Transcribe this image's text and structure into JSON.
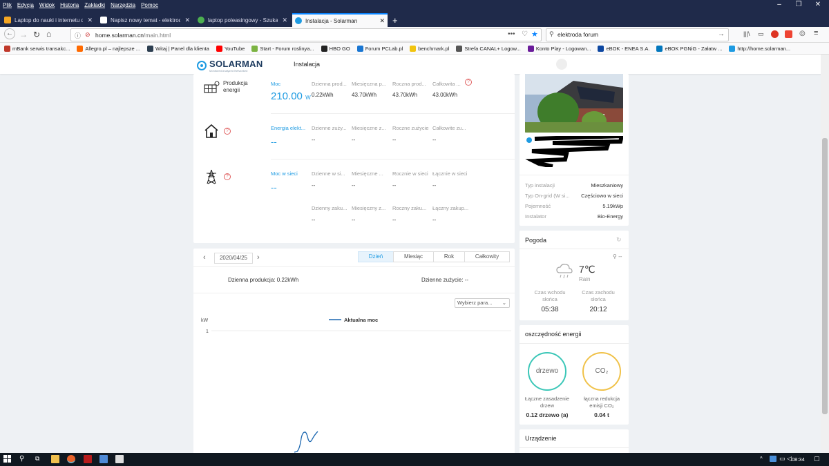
{
  "browser": {
    "menu": [
      "Plik",
      "Edycja",
      "Widok",
      "Historia",
      "Zakładki",
      "Narzędzia",
      "Pomoc"
    ],
    "tabs": [
      {
        "title": "Laptop do nauki i internetu do",
        "color": "#f5a623"
      },
      {
        "title": "Napisz nowy temat - elektroda",
        "color": "#ffffff"
      },
      {
        "title": "laptop poleasingowy - Szukaj w",
        "color": "#4caf50"
      },
      {
        "title": "Instalacja - Solarman",
        "color": "#1e9be2"
      }
    ],
    "url_host": "home.solarman.cn",
    "url_path": "/main.html",
    "search_value": "elektroda forum",
    "bookmarks": [
      {
        "label": "mBank serwis transakc...",
        "color": "#c0392b"
      },
      {
        "label": "Allegro.pl – najlepsze ...",
        "color": "#ff6a00"
      },
      {
        "label": "Witaj | Panel dla klienta",
        "color": "#2c3e50"
      },
      {
        "label": "YouTube",
        "color": "#ff0000"
      },
      {
        "label": "Start - Forum roslinya...",
        "color": "#7cb342"
      },
      {
        "label": "HBO GO",
        "color": "#222222"
      },
      {
        "label": "Forum PCLab.pl",
        "color": "#1976d2"
      },
      {
        "label": "benchmark.pl",
        "color": "#f1c40f"
      },
      {
        "label": "Strefa CANAL+ Logow...",
        "color": "#555555"
      },
      {
        "label": "Konto Play - Logowan...",
        "color": "#6a1b9a"
      },
      {
        "label": "eBOK - ENEA S.A.",
        "color": "#0d47a1"
      },
      {
        "label": "eBOK PGNiG - Załatw ...",
        "color": "#0277bd"
      },
      {
        "label": "http://home.solarman...",
        "color": "#1e9be2"
      }
    ]
  },
  "app": {
    "logo": "SOLARMAN",
    "logo_sub": "Monitored Analyzed Networked",
    "nav": "Instalacja"
  },
  "energy": {
    "production": {
      "title": "Produkcja energii",
      "power_label": "Moc",
      "power_value": "210.00",
      "power_unit": "W",
      "cols": [
        {
          "label": "Dzienna prod...",
          "value": "0.22kWh"
        },
        {
          "label": "Miesięczna p...",
          "value": "43.70kWh"
        },
        {
          "label": "Roczna prod...",
          "value": "43.70kWh"
        },
        {
          "label": "Całkowita ...",
          "value": "43.00kWh"
        }
      ]
    },
    "consumption": {
      "power_label": "Energia elekt...",
      "power_value": "--",
      "cols": [
        {
          "label": "Dzienne zuży...",
          "value": "--"
        },
        {
          "label": "Miesięczne z...",
          "value": "--"
        },
        {
          "label": "Roczne zużycie",
          "value": "--"
        },
        {
          "label": "Całkowite zu...",
          "value": "--"
        }
      ]
    },
    "grid": {
      "power_label": "Moc w sieci",
      "power_value": "--",
      "cols": [
        {
          "label": "Dzienne w si...",
          "value": "--"
        },
        {
          "label": "Miesięczne ...",
          "value": "--"
        },
        {
          "label": "Rocznie w sieci",
          "value": "--"
        },
        {
          "label": "Łącznie w sieci",
          "value": "--"
        }
      ],
      "cols2": [
        {
          "label": "Dzienny zaku...",
          "value": "--"
        },
        {
          "label": "Miesięczny z...",
          "value": "--"
        },
        {
          "label": "Roczny zaku...",
          "value": "--"
        },
        {
          "label": "Łączny zakup...",
          "value": "--"
        }
      ]
    }
  },
  "chart": {
    "date": "2020/04/25",
    "ranges": [
      "Dzień",
      "Miesiąc",
      "Rok",
      "Całkowity"
    ],
    "active_range": "Dzień",
    "daily_production": "Dzienna produkcja: 0.22kWh",
    "daily_consumption": "Dzienne zużycie: --",
    "param_select": "Wybierz para...",
    "chart_data": {
      "type": "line",
      "ylabel": "kW",
      "series": [
        {
          "name": "Aktualna moc",
          "values": []
        }
      ],
      "yticks": [
        "1"
      ]
    }
  },
  "plant": {
    "rows": [
      {
        "k": "Typ instalacji",
        "v": "Mieszkaniowy"
      },
      {
        "k": "Typ On-grid (W si...",
        "v": "Częściowo w sieci"
      },
      {
        "k": "Pojemność",
        "v": "5.19kWp"
      },
      {
        "k": "Instalator",
        "v": "Bio-Energy"
      }
    ]
  },
  "weather": {
    "title": "Pogoda",
    "location": "--",
    "temp": "7℃",
    "cond": "Rain",
    "sunrise_label": "Czas wchodu słońca",
    "sunrise": "05:38",
    "sunset_label": "Czas zachodu słońca",
    "sunset": "20:12"
  },
  "savings": {
    "title": "oszczędność energii",
    "tree_badge": "drzewo",
    "co2_badge": "CO₂",
    "tree_label": "Łączne zasadzenie drzew",
    "tree_value": "0.12 drzewo (a)",
    "co2_label": "łączna redukcja emisji CO₂",
    "co2_value": "0.04 t"
  },
  "device": {
    "title": "Urządzenie"
  },
  "taskbar": {
    "time": "08:34"
  }
}
